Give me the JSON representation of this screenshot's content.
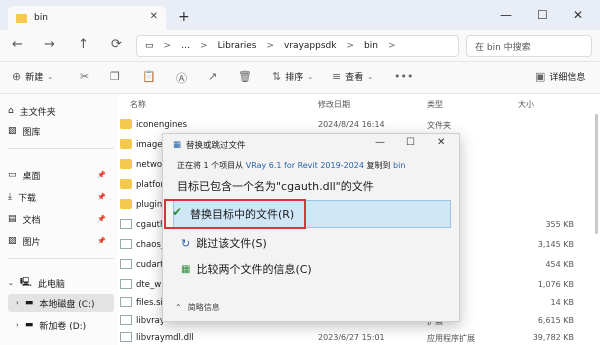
{
  "titlebar": {
    "tab_title": "bin",
    "close": "✕",
    "new_tab": "+",
    "minimize": "—",
    "maximize": "☐",
    "close_window": "✕"
  },
  "navbar": {
    "back": "←",
    "forward": "→",
    "up": "↑",
    "refresh": "⟳",
    "monitor": "▭",
    "more": "…",
    "breadcrumb": [
      "Libraries",
      "vrayappsdk",
      "bin"
    ],
    "sep": ">",
    "search_placeholder": "在 bin 中搜索"
  },
  "toolbar": {
    "new_label": "新建",
    "new_icon": "⊕",
    "cut_icon": "✂",
    "copy_icon": "❐",
    "paste_icon": "📋",
    "rename_icon": "Ⓐ",
    "share_icon": "↗",
    "delete_icon": "🗑",
    "sort_label": "排序",
    "sort_icon": "⇅",
    "view_label": "查看",
    "view_icon": "≡",
    "more_icon": "•••",
    "details_label": "详细信息",
    "details_icon": "▣"
  },
  "sidebar": {
    "items": [
      {
        "label": "主文件夹",
        "icon": "⌂"
      },
      {
        "label": "图库",
        "icon": "▨"
      },
      {
        "label": "桌面",
        "icon": "▭"
      },
      {
        "label": "下载",
        "icon": "⤓"
      },
      {
        "label": "文档",
        "icon": "▤"
      },
      {
        "label": "图片",
        "icon": "▨"
      },
      {
        "label": "此电脑",
        "icon": "🖳"
      },
      {
        "label": "本地磁盘 (C:)",
        "icon": "▬"
      },
      {
        "label": "新加卷 (D:)",
        "icon": "▬"
      }
    ],
    "pin": "📌"
  },
  "columns": {
    "name": "名称",
    "date": "修改日期",
    "type": "类型",
    "size": "大小"
  },
  "files": [
    {
      "name": "iconengines",
      "date": "2024/8/24 16:14",
      "type": "文件夹",
      "size": "",
      "kind": "folder"
    },
    {
      "name": "image",
      "date": "",
      "type": "",
      "size": "",
      "kind": "folder"
    },
    {
      "name": "netwo",
      "date": "",
      "type": "",
      "size": "",
      "kind": "folder"
    },
    {
      "name": "platfor",
      "date": "",
      "type": "",
      "size": "",
      "kind": "folder"
    },
    {
      "name": "plugin",
      "date": "",
      "type": "",
      "size": "",
      "kind": "folder"
    },
    {
      "name": "cgauth",
      "date": "",
      "type": "扩展",
      "size": "355 KB",
      "kind": "file"
    },
    {
      "name": "chaos_",
      "date": "",
      "type": "扩展",
      "size": "3,145 KB",
      "kind": "file"
    },
    {
      "name": "cudart",
      "date": "",
      "type": "扩展",
      "size": "454 KB",
      "kind": "file"
    },
    {
      "name": "dte_w",
      "date": "",
      "type": "扩展",
      "size": "1,076 KB",
      "kind": "file"
    },
    {
      "name": "files.si",
      "date": "",
      "type": "",
      "size": "14 KB",
      "kind": "file"
    },
    {
      "name": "libvray",
      "date": "",
      "type": "扩展",
      "size": "6,615 KB",
      "kind": "file"
    },
    {
      "name": "libvraymdl.dll",
      "date": "2023/6/27 15:01",
      "type": "应用程序扩展",
      "size": "39,782 KB",
      "kind": "file"
    }
  ],
  "dialog": {
    "title": "替换或跳过文件",
    "title_icon": "▦",
    "minimize": "—",
    "maximize": "☐",
    "close": "✕",
    "line1_prefix": "正在将 1 个项目从 ",
    "line1_source": "VRay 6.1 for Revit 2019-2024",
    "line1_mid": " 复制到 ",
    "line1_dest": "bin",
    "line2": "目标已包含一个名为\"cgauth.dll\"的文件",
    "option_replace": "替换目标中的文件(R)",
    "option_skip": "跳过该文件(S)",
    "option_compare": "比较两个文件的信息(C)",
    "replace_icon": "✔",
    "skip_icon": "↻",
    "compare_icon": "▦",
    "details_label": "简略信息",
    "details_icon": "⌃"
  },
  "colors": {
    "accent": "#2a64a8",
    "selected_option_bg": "#cfe6f7",
    "highlight_border": "#d9353c",
    "folder": "#f5c94d"
  }
}
